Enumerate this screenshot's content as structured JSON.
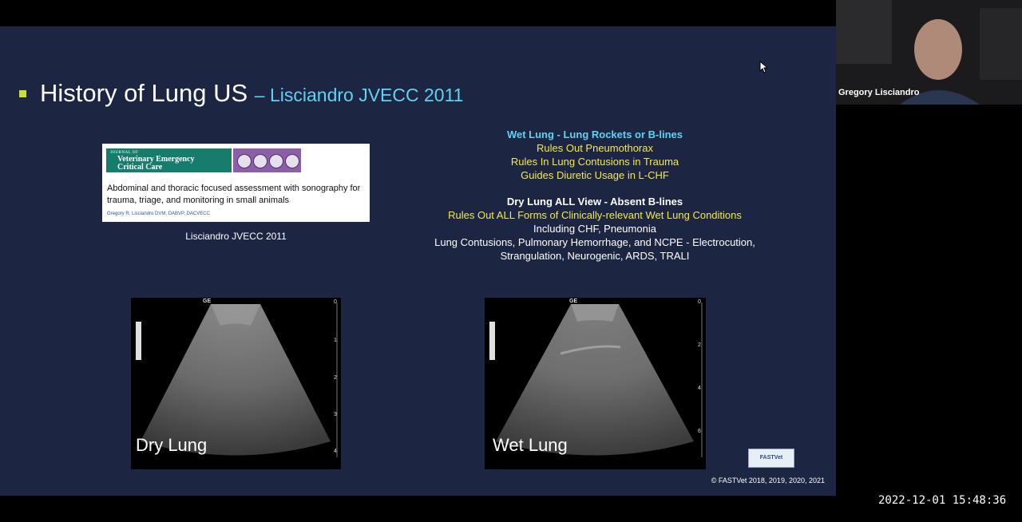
{
  "slide": {
    "title_main": "History of Lung US",
    "title_sub": "– Lisciandro JVECC 2011",
    "journal": {
      "journal_small": "JOURNAL OF",
      "journal_line1": "Veterinary Emergency",
      "journal_line2": "Critical Care",
      "article_title": "Abdominal and thoracic focused assessment with sonography for trauma, triage, and monitoring in small animals",
      "article_author": "Gregory R. Lisciandro DVM, DABVP, DACVECC",
      "caption": "Lisciandro JVECC 2011"
    },
    "wet_block": {
      "heading": "Wet Lung - Lung Rockets or B-lines",
      "lines": [
        "Rules Out Pneumothorax",
        "Rules In Lung Contusions in Trauma",
        "Guides Diuretic Usage in L-CHF"
      ]
    },
    "dry_block": {
      "heading": "Dry Lung ALL View - Absent B-lines",
      "line1": "Rules Out ALL Forms of Clinically-relevant Wet Lung Conditions",
      "line2": "Including CHF, Pneumonia",
      "line3": "Lung Contusions, Pulmonary Hemorrhage, and NCPE - Electrocution,",
      "line4": "Strangulation, Neurogenic, ARDS, TRALI"
    },
    "ultrasound_panels": [
      {
        "label": "Dry Lung",
        "brand": "GE",
        "depth_ticks": [
          "0",
          "1",
          "2",
          "3",
          "4"
        ]
      },
      {
        "label": "Wet Lung",
        "brand": "GE",
        "depth_ticks": [
          "0",
          "2",
          "4",
          "6"
        ]
      }
    ],
    "logo_text": "FASTVet",
    "copyright": "© FASTVet 2018, 2019, 2020, 2021"
  },
  "webcam": {
    "name": "Gregory Lisciandro"
  },
  "timestamp": "2022-12-01 15:48:36",
  "colors": {
    "slide_bg": "#1c2541",
    "title_accent": "#5fd3f3",
    "highlight": "#f5e94a",
    "bullet": "#c9e03c"
  }
}
